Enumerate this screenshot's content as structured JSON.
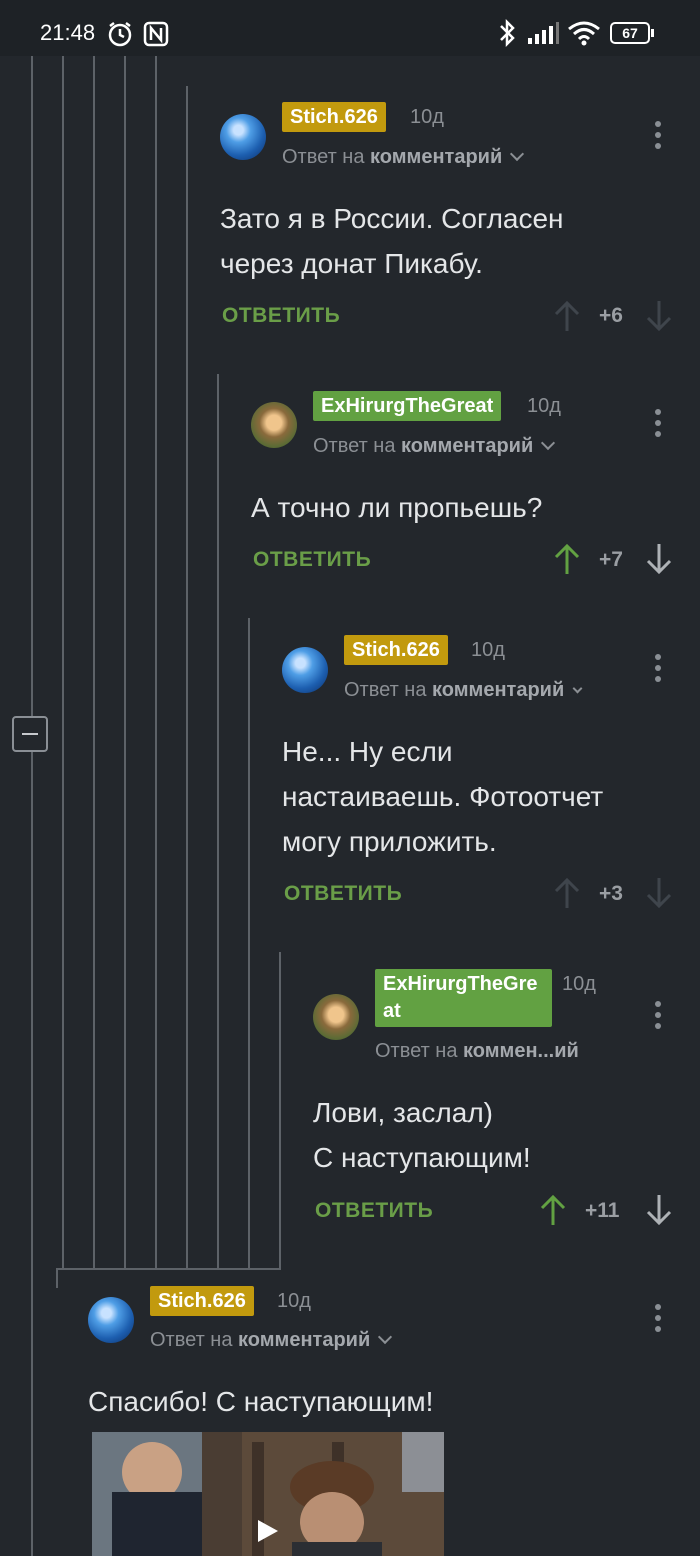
{
  "status_bar": {
    "time": "21:48",
    "battery": "67"
  },
  "common": {
    "reply_label": "ОТВЕТИТЬ",
    "reply_to_prefix": "Ответ на "
  },
  "comments": [
    {
      "author": "Stich.626",
      "date": "10д",
      "reply_to": "комментарий",
      "text": "Зато я в России. Согласен\nчерез донат Пикабу.",
      "score": "+6"
    },
    {
      "author": "ExHirurgTheGreat",
      "date": "10д",
      "reply_to": "комментарий",
      "text": "А точно ли пропьешь?",
      "score": "+7"
    },
    {
      "author": "Stich.626",
      "date": "10д",
      "reply_to": "комментарий",
      "text": "Не... Ну если\nнастаиваешь. Фотоотчет\nмогу приложить.",
      "score": "+3"
    },
    {
      "author": "ExHirurgTheGreat",
      "date": "10д",
      "reply_to": "коммен...ий",
      "text": "Лови, заслал)\nС наступающим!",
      "score": "+11"
    },
    {
      "author": "Stich.626",
      "date": "10д",
      "reply_to": "комментарий",
      "text": "Спасибо! С наступающим!",
      "score": ""
    }
  ],
  "colors": {
    "background": "#23272c",
    "gold_badge": "#c29a0e",
    "green_badge": "#62a142",
    "reply_green": "#6a9e48"
  }
}
